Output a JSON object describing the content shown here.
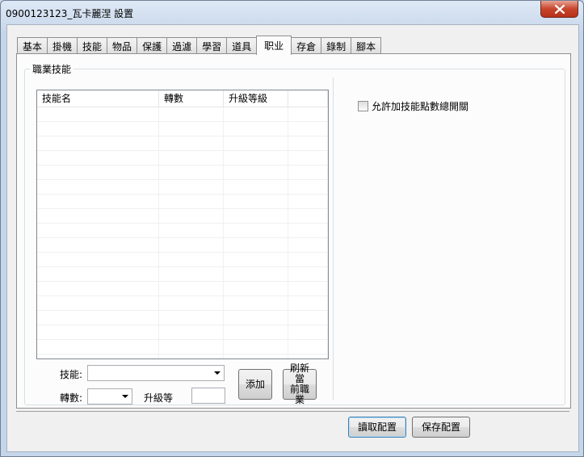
{
  "window": {
    "title": "0900123123_瓦卡麗涅  設置"
  },
  "tabs": [
    {
      "label": "基本"
    },
    {
      "label": "掛機"
    },
    {
      "label": "技能"
    },
    {
      "label": "物品"
    },
    {
      "label": "保護"
    },
    {
      "label": "過濾"
    },
    {
      "label": "學習"
    },
    {
      "label": "道具"
    },
    {
      "label": "职业"
    },
    {
      "label": "存倉"
    },
    {
      "label": "錄制"
    },
    {
      "label": "腳本"
    }
  ],
  "active_tab": "职业",
  "group": {
    "title": "職業技能"
  },
  "list": {
    "columns": [
      "技能名",
      "轉數",
      "升級等級",
      ""
    ]
  },
  "form": {
    "skill_label": "技能:",
    "turn_label": "轉數:",
    "level_label": "升級等",
    "add_button": "添加",
    "refresh_line1": "刷新當",
    "refresh_line2": "前職業"
  },
  "checkbox": {
    "label": "允許加技能點數總開關",
    "checked": false
  },
  "footer": {
    "read_button": "讀取配置",
    "save_button": "保存配置"
  },
  "colors": {
    "accent": "#3c7fb1",
    "close": "#c7452c"
  }
}
